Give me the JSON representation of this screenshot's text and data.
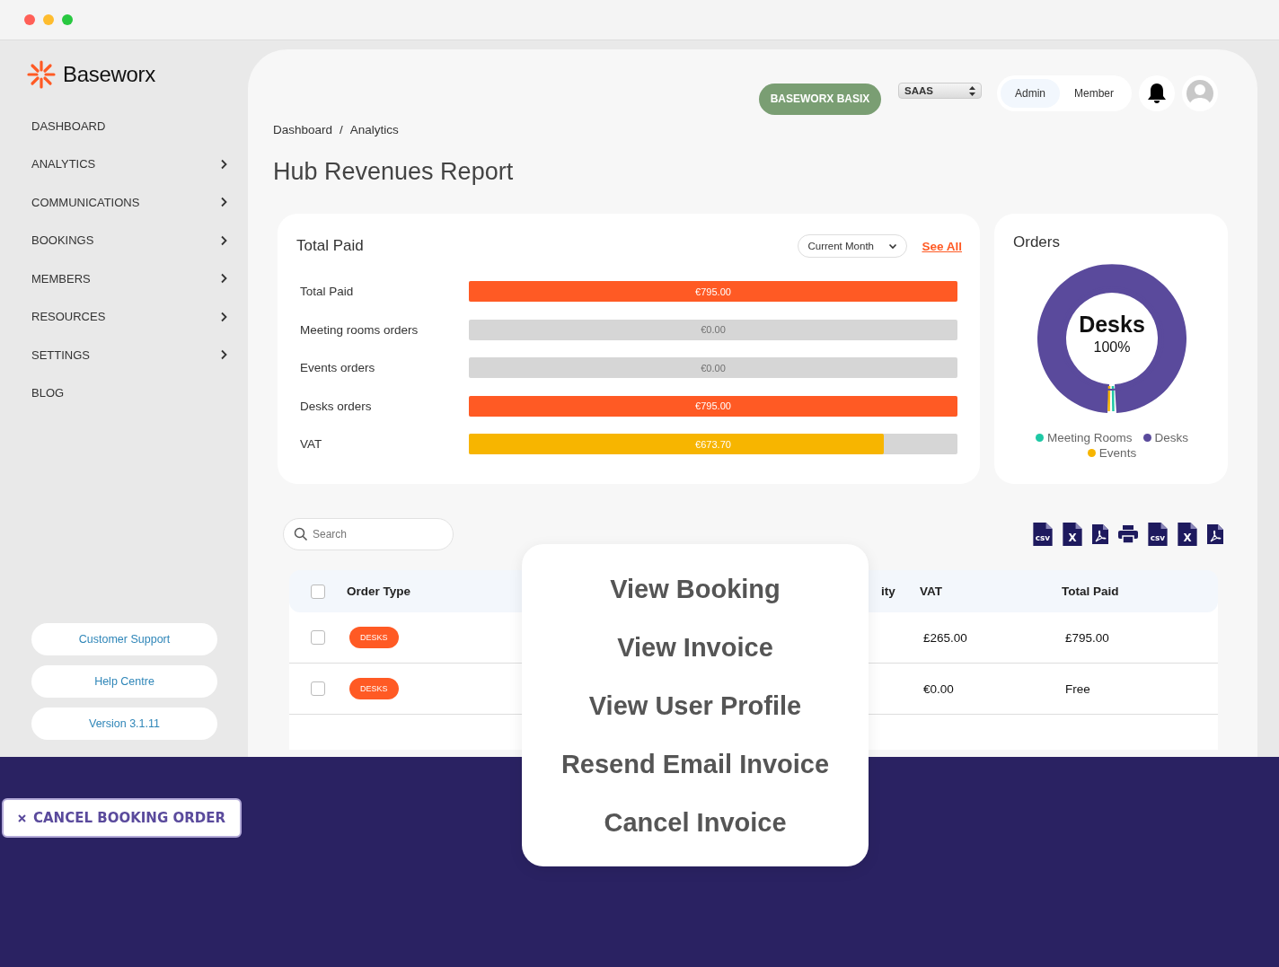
{
  "brand": {
    "name": "Baseworx"
  },
  "sidebar": {
    "items": [
      {
        "label": "DASHBOARD",
        "expandable": false
      },
      {
        "label": "ANALYTICS",
        "expandable": true
      },
      {
        "label": "COMMUNICATIONS",
        "expandable": true
      },
      {
        "label": "BOOKINGS",
        "expandable": true
      },
      {
        "label": "MEMBERS",
        "expandable": true
      },
      {
        "label": "RESOURCES",
        "expandable": true
      },
      {
        "label": "SETTINGS",
        "expandable": true
      },
      {
        "label": "BLOG",
        "expandable": false
      }
    ],
    "buttons": [
      "Customer Support",
      "Help Centre",
      "Version 3.1.11"
    ]
  },
  "header": {
    "plan_button": "BASEWORX BASIX",
    "select": "SAAS",
    "roles": [
      {
        "label": "Admin",
        "selected": true
      },
      {
        "label": "Member",
        "selected": false
      }
    ]
  },
  "breadcrumb": [
    "Dashboard",
    "/",
    "Analytics"
  ],
  "title": "Hub Revenues Report",
  "total_paid": {
    "title": "Total Paid",
    "period": "Current Month",
    "link": "See All",
    "rows": [
      {
        "label": "Total Paid",
        "value": "€795.00",
        "level": 1,
        "color": "#ff5a24"
      },
      {
        "label": "Meeting rooms orders",
        "value": "€0.00"
      },
      {
        "label": "Events orders",
        "value": "€0.00"
      },
      {
        "label": "Desks orders",
        "value": "€795.00",
        "level": 1,
        "color": "#ff5a24"
      },
      {
        "label": "VAT",
        "value": "€673.70",
        "level": 0.85,
        "color": "#f7b500"
      }
    ]
  },
  "orders": {
    "title": "Orders",
    "center_label": "Desks",
    "center_value": "100%",
    "legend": [
      {
        "label": "Meeting Rooms",
        "color": "#1ec8a5"
      },
      {
        "label": "Desks",
        "color": "#5a4a9c"
      },
      {
        "label": "Events",
        "color": "#f7b500"
      }
    ]
  },
  "search": {
    "placeholder": "Search"
  },
  "exports": [
    {
      "kind": "csv",
      "label": "csv"
    },
    {
      "kind": "excel",
      "label": "X"
    },
    {
      "kind": "pdf"
    },
    {
      "kind": "print"
    },
    {
      "kind": "csv",
      "label": "csv"
    },
    {
      "kind": "excel",
      "label": "X"
    },
    {
      "kind": "pdf"
    }
  ],
  "table": {
    "select_all_checked": false,
    "columns": [
      "Order Type",
      "ity",
      "VAT",
      "Total Paid"
    ],
    "rows": [
      {
        "checked": false,
        "type": "DESKS",
        "vat": "£265.00",
        "total": "£795.00"
      },
      {
        "checked": false,
        "type": "DESKS",
        "vat": "€0.00",
        "total": "Free"
      }
    ]
  },
  "menu": [
    "View Booking",
    "View Invoice",
    "View User Profile",
    "Resend Email Invoice",
    "Cancel Invoice"
  ],
  "cancel_button": "CANCEL BOOKING ORDER"
}
